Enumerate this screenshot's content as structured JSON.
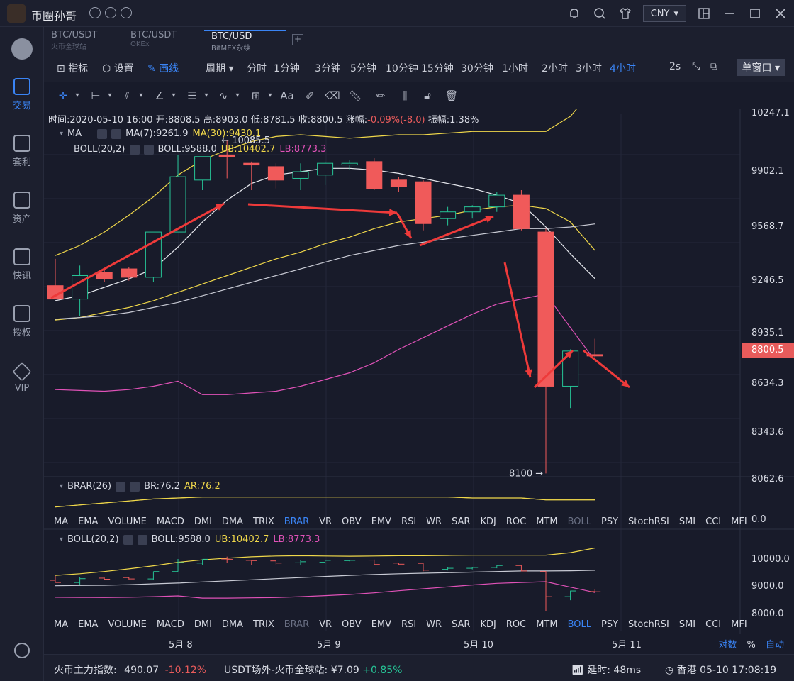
{
  "app": {
    "name": "币圈孙哥",
    "currency": "CNY"
  },
  "sidebar": {
    "items": [
      {
        "label": "交易",
        "icon": "trade-icon",
        "active": true
      },
      {
        "label": "套利",
        "icon": "arbitrage-icon"
      },
      {
        "label": "资产",
        "icon": "wallet-icon"
      },
      {
        "label": "快讯",
        "icon": "news-icon"
      },
      {
        "label": "授权",
        "icon": "key-icon"
      },
      {
        "label": "VIP",
        "icon": "vip-icon"
      }
    ]
  },
  "tabs": [
    {
      "pair": "BTC/USDT",
      "exchange": "火币全球站"
    },
    {
      "pair": "BTC/USDT",
      "exchange": "OKEx"
    },
    {
      "pair": "BTC/USD",
      "exchange": "BitMEX永续",
      "active": true
    }
  ],
  "toolbar": {
    "indicators": "指标",
    "settings": "设置",
    "draw": "画线",
    "period": "周期",
    "periods": [
      "分时",
      "1分钟",
      "3分钟",
      "5分钟",
      "10分钟",
      "15分钟",
      "30分钟",
      "1小时",
      "2小时",
      "3小时",
      "4小时"
    ],
    "active_period": "4小时",
    "refresh": "2s",
    "window": "单窗口"
  },
  "candle_info": {
    "time": "时间:2020-05-10 16:00",
    "open": "开:8808.5",
    "high": "高:8903.0",
    "low": "低:8781.5",
    "close": "收:8800.5",
    "change_label": "涨幅:",
    "change": "-0.09%(-8.0)",
    "amplitude": "振幅:1.38%"
  },
  "legend": {
    "ma": "MA",
    "ma7": "MA(7):9261.9",
    "ma30": "MA(30):9430.1",
    "boll": "BOLL(20,2)",
    "boll_mid": "BOLL:9588.0",
    "boll_ub": "UB:10402.7",
    "boll_lb": "LB:8773.3",
    "brar": "BRAR(26)",
    "br": "BR:76.2",
    "ar": "AR:76.2"
  },
  "annotations": {
    "high": "← 10085.5",
    "low": "8100 →"
  },
  "indicator_tabs": [
    "MA",
    "EMA",
    "VOLUME",
    "MACD",
    "DMI",
    "DMA",
    "TRIX",
    "BRAR",
    "VR",
    "OBV",
    "EMV",
    "RSI",
    "WR",
    "SAR",
    "KDJ",
    "ROC",
    "MTM",
    "BOLL",
    "PSY",
    "StochRSI",
    "SMI",
    "CCI",
    "MFI"
  ],
  "indicator_tabs_selected_1": "BRAR",
  "indicator_tabs_selected_2": "BOLL",
  "price_axis": [
    "10247.1",
    "9902.1",
    "9568.7",
    "9246.5",
    "8935.1",
    "8800.5",
    "8634.3",
    "8343.6",
    "8062.6"
  ],
  "brar_axis": "0.0",
  "boll_axis": [
    "10000.0",
    "9000.0",
    "8000.0"
  ],
  "dates": [
    "5月 8",
    "5月 9",
    "5月 10",
    "5月 11"
  ],
  "axis_opts": {
    "log": "对数",
    "pct": "%",
    "auto": "自动"
  },
  "status": {
    "index_label": "火币主力指数:",
    "index_value": "490.07",
    "index_change": "-10.12%",
    "otc_label": "USDT场外-火币全球站:",
    "otc_value": "¥7.09",
    "otc_change": "+0.85%",
    "latency_label": "延时:",
    "latency": "48ms",
    "clock": "香港 05-10 17:08:19"
  },
  "colors": {
    "up": "#26c496",
    "down": "#f05a5a",
    "ma7": "#e6e8ee",
    "ma30": "#f0d84a",
    "lb": "#e052b8",
    "accent": "#3a84f5"
  },
  "chart_data": {
    "type": "candlestick",
    "candles": [
      {
        "o": 9220,
        "h": 9380,
        "l": 9160,
        "c": 9140
      },
      {
        "o": 9140,
        "h": 9340,
        "l": 9040,
        "c": 9280
      },
      {
        "o": 9300,
        "h": 9320,
        "l": 9240,
        "c": 9260
      },
      {
        "o": 9320,
        "h": 9330,
        "l": 9250,
        "c": 9270
      },
      {
        "o": 9270,
        "h": 9540,
        "l": 9240,
        "c": 9540
      },
      {
        "o": 9540,
        "h": 10000,
        "l": 9540,
        "c": 9870
      },
      {
        "o": 9850,
        "h": 9990,
        "l": 9790,
        "c": 9990
      },
      {
        "o": 10000,
        "h": 10085.5,
        "l": 9860,
        "c": 9990
      },
      {
        "o": 9950,
        "h": 9960,
        "l": 9790,
        "c": 9940
      },
      {
        "o": 9930,
        "h": 9950,
        "l": 9800,
        "c": 9850
      },
      {
        "o": 9860,
        "h": 9950,
        "l": 9790,
        "c": 9900
      },
      {
        "o": 9880,
        "h": 9960,
        "l": 9820,
        "c": 9950
      },
      {
        "o": 9940,
        "h": 9970,
        "l": 9910,
        "c": 9950
      },
      {
        "o": 9960,
        "h": 9980,
        "l": 9790,
        "c": 9800
      },
      {
        "o": 9850,
        "h": 9870,
        "l": 9780,
        "c": 9810
      },
      {
        "o": 9840,
        "h": 9850,
        "l": 9550,
        "c": 9590
      },
      {
        "o": 9620,
        "h": 9690,
        "l": 9580,
        "c": 9660
      },
      {
        "o": 9660,
        "h": 9700,
        "l": 9620,
        "c": 9690
      },
      {
        "o": 9690,
        "h": 9780,
        "l": 9660,
        "c": 9760
      },
      {
        "o": 9760,
        "h": 9790,
        "l": 9550,
        "c": 9560
      },
      {
        "o": 9540,
        "h": 9560,
        "l": 8100,
        "c": 8620
      },
      {
        "o": 8620,
        "h": 8840,
        "l": 8490,
        "c": 8830
      },
      {
        "o": 8808.5,
        "h": 8903.0,
        "l": 8781.5,
        "c": 8800.5
      }
    ],
    "ma7": [
      9130,
      9160,
      9210,
      9260,
      9320,
      9450,
      9600,
      9730,
      9830,
      9880,
      9900,
      9920,
      9920,
      9910,
      9890,
      9860,
      9830,
      9800,
      9760,
      9710,
      9570,
      9410,
      9261.9
    ],
    "ma30": [
      9015,
      9030,
      9060,
      9090,
      9130,
      9180,
      9230,
      9280,
      9330,
      9380,
      9420,
      9470,
      9510,
      9560,
      9600,
      9620,
      9640,
      9670,
      9690,
      9700,
      9680,
      9600,
      9430.1
    ],
    "boll_ub": [
      9400,
      9460,
      9540,
      9640,
      9750,
      9880,
      9970,
      10030,
      10080,
      10110,
      10120,
      10110,
      10100,
      10110,
      10120,
      10120,
      10130,
      10140,
      10140,
      10140,
      10140,
      10230,
      10402.7
    ],
    "boll_mid": [
      9020,
      9030,
      9040,
      9060,
      9090,
      9120,
      9160,
      9200,
      9240,
      9280,
      9320,
      9360,
      9400,
      9430,
      9460,
      9480,
      9500,
      9520,
      9540,
      9560,
      9560,
      9570,
      9588.0
    ],
    "boll_lb": [
      8600,
      8595,
      8590,
      8600,
      8620,
      8650,
      8570,
      8570,
      8580,
      8590,
      8620,
      8660,
      8700,
      8760,
      8840,
      8910,
      8980,
      9050,
      9110,
      9140,
      9170,
      8970,
      8773.3
    ],
    "brar": [
      62,
      66,
      70,
      74,
      78,
      80,
      82,
      82,
      82,
      82,
      82,
      82,
      82,
      82,
      82,
      82,
      82,
      80,
      80,
      80,
      76.2,
      76.2,
      76.2
    ],
    "ylim": [
      7950,
      10550
    ]
  }
}
